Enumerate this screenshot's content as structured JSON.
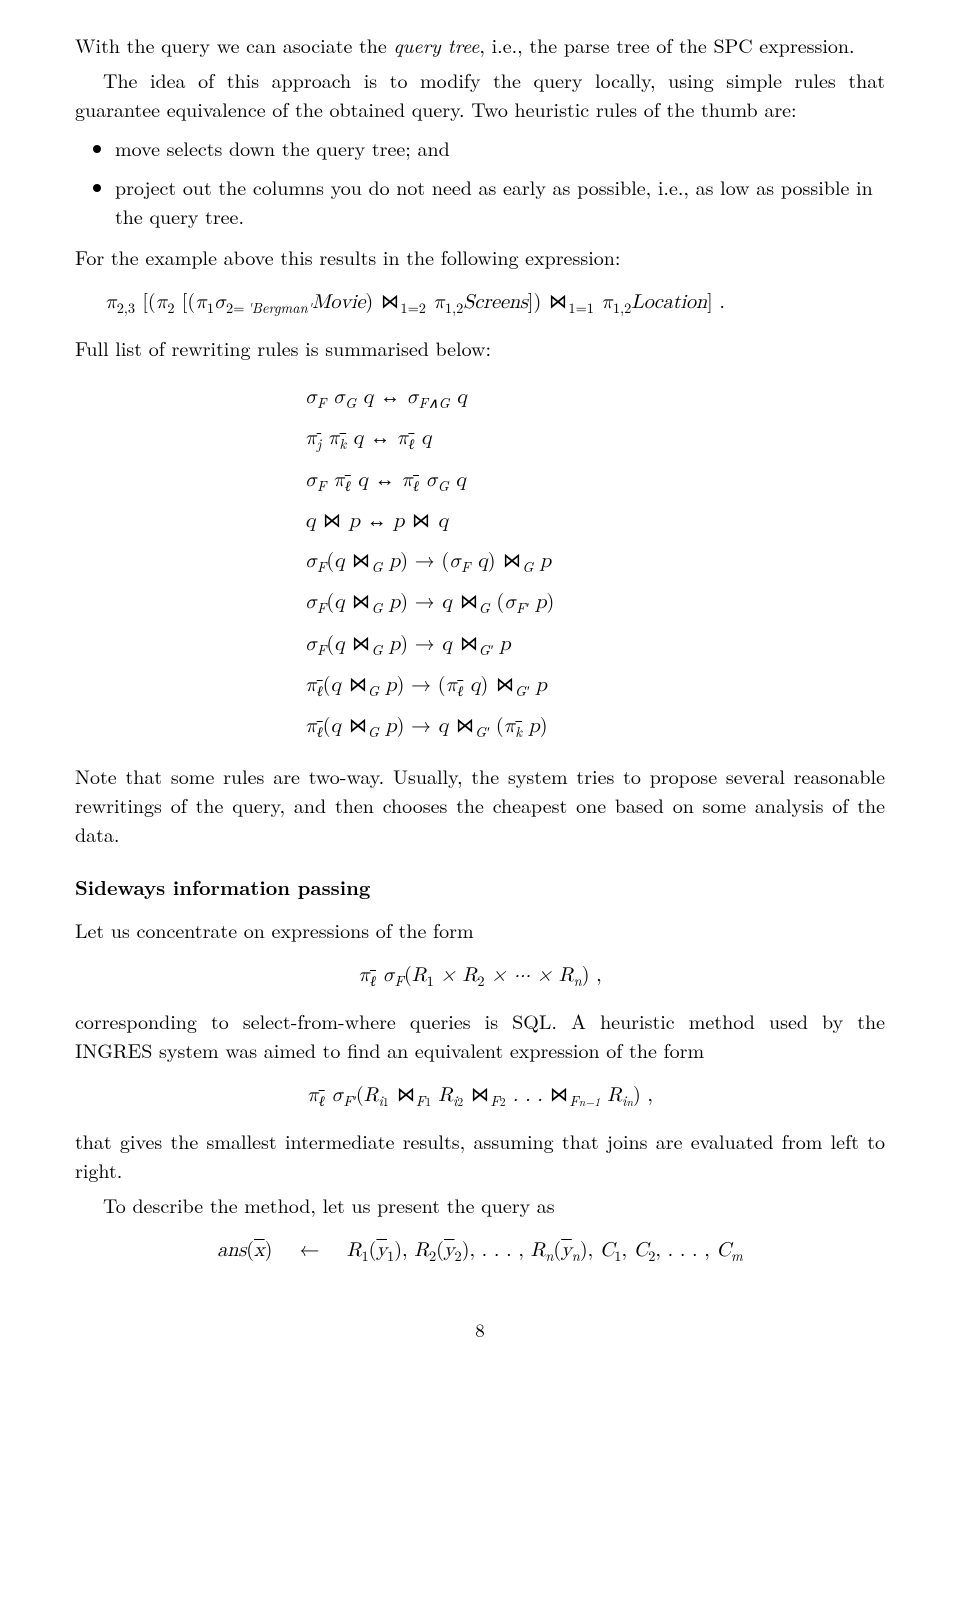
{
  "para1": "With the query we can asociate the ",
  "para1_it1": "query tree",
  "para1_cont": ", i.e., the parse tree of the SPC expression.",
  "para2": "The idea of this approach is to modify the query locally, using simple rules that guarantee equivalence of the obtained query. Two heuristic rules of the thumb are:",
  "bullet1": "move selects down the query tree; and",
  "bullet2": "project out the columns you do not need as early as possible, i.e., as low as possible in the query tree.",
  "para3": "For the example above this results in the following expression:",
  "expr1_pre": "π",
  "expr1": "[(π₂ [(π₁σ₂₌ 'Bergman' Movie) ⋈₁₌₂ π₁,₂Screens]) ⋈₁₌₁ π₁,₂Location] .",
  "para4": "Full list of rewriting rules is summarised below:",
  "rules": [
    "σF σG q ↔ σF∧G q",
    "πj̄ πk̄ q ↔ πℓ̄ q",
    "σF πℓ̄ q ↔ πℓ̄ σG q",
    "q ⋈ p ↔ p ⋈ q",
    "σF(q ⋈G p) → (σF q) ⋈G p",
    "σF(q ⋈G p) → q ⋈G (σF′ p)",
    "σF(q ⋈G p) → q ⋈G′ p",
    "πℓ̄(q ⋈G p) → (πℓ̄ q) ⋈G′ p",
    "πℓ̄(q ⋈G p) → q ⋈G′ (πk̄ p)"
  ],
  "para5": "Note that some rules are two-way. Usually, the system tries to propose several reasonable rewritings of the query, and then chooses the cheapest one based on some analysis of the data.",
  "heading1": "Sideways information passing",
  "para6": "Let us concentrate on expressions of the form",
  "expr2": "πℓ̄ σF (R₁ × R₂ × ··· × Rn) ,",
  "para7": "corresponding to select-from-where queries is SQL. A heuristic method used by the INGRES system was aimed to find an equivalent expression of the form",
  "expr3": "πℓ̄ σF′ (Ri₁ ⋈F₁ Ri₂ ⋈F₂ ... ⋈Fn₋₁ Rin) ,",
  "para8": "that gives the smallest intermediate results, assuming that joins are evaluated from left to right.",
  "para9": "To describe the method, let us present the query as",
  "expr4": "ans(x̄)  ←  R₁(ȳ₁), R₂(ȳ₂), . . . , Rn(ȳn), C₁, C₂, . . . , Cm",
  "pagenum": "8"
}
